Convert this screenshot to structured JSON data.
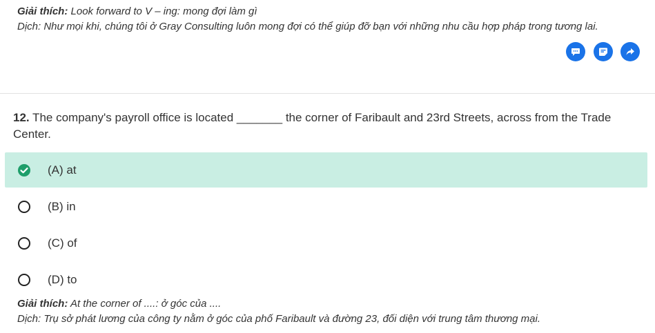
{
  "prev_explanation": {
    "label1": "Giải thích:",
    "text1": " Look forward to V – ing: mong đợi làm gì",
    "line2": "Dịch: Như mọi khi, chúng tôi ở Gray Consulting luôn mong đợi có thể giúp đỡ bạn với những nhu cầu hợp pháp trong tương lai."
  },
  "actions": [
    {
      "name": "comment",
      "icon": "comment-icon"
    },
    {
      "name": "note",
      "icon": "note-icon"
    },
    {
      "name": "share",
      "icon": "share-icon"
    }
  ],
  "question": {
    "number": "12.",
    "text": " The company's payroll office is located _______ the corner of Faribault and 23rd Streets, across from the Trade Center."
  },
  "options": [
    {
      "label": "(A) at",
      "correct": true
    },
    {
      "label": "(B) in",
      "correct": false
    },
    {
      "label": "(C) of",
      "correct": false
    },
    {
      "label": "(D) to",
      "correct": false
    }
  ],
  "explanation": {
    "label1": "Giải thích:",
    "text1": " At the corner of ....: ở góc của ....",
    "line2": "Dịch: Trụ sở phát lương của công ty nằm ở góc của phố Faribault và đường 23, đối diện với trung tâm thương mại."
  },
  "colors": {
    "accent": "#1a73e8",
    "correct_bg": "#c9eee3",
    "correct_check": "#1e9e6a"
  }
}
